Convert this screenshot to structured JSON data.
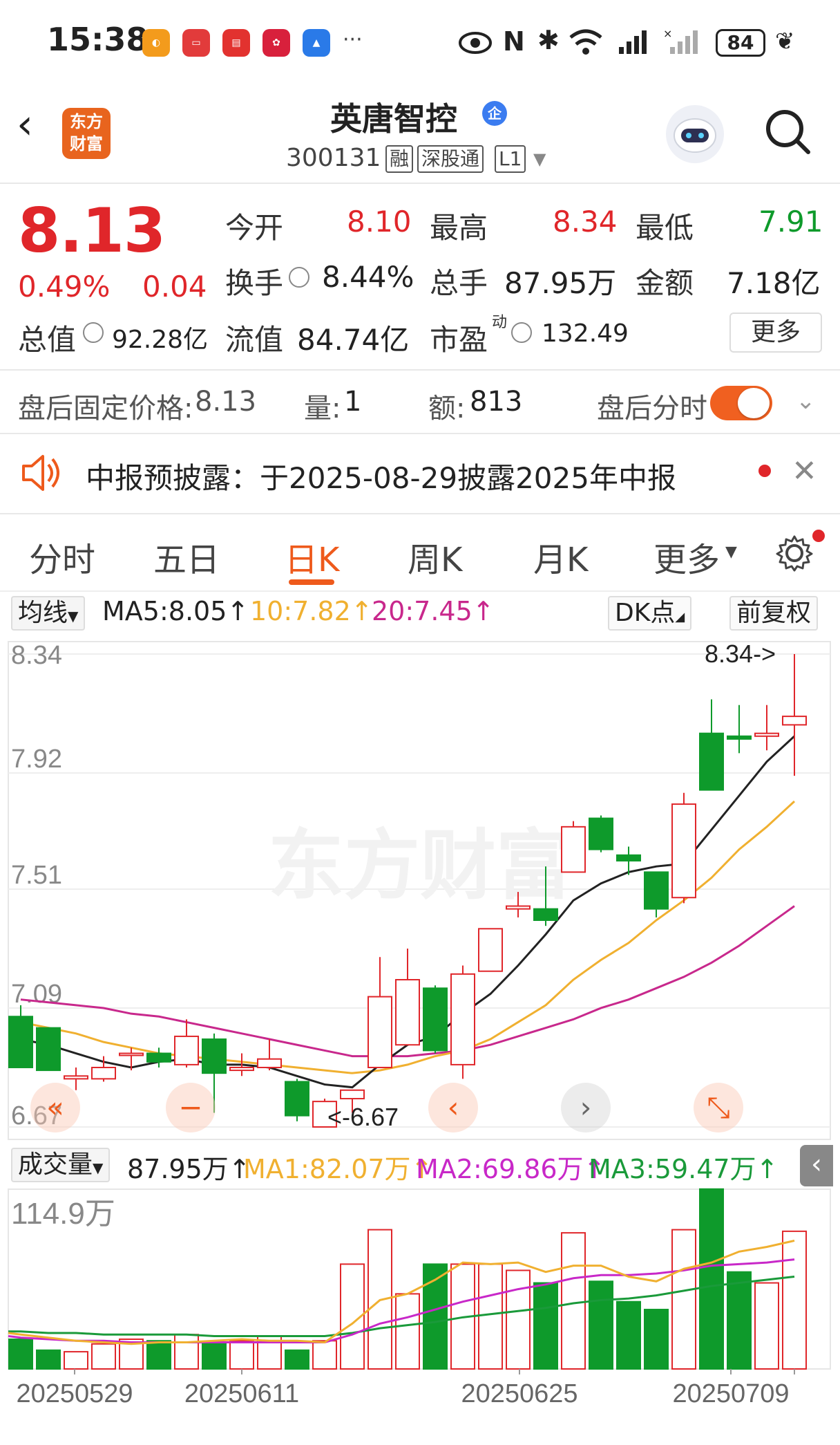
{
  "status_bar": {
    "time": "15:38",
    "battery": "84"
  },
  "header": {
    "logo_text": "东方财富",
    "stock_name": "英唐智控",
    "name_badge": "企",
    "stock_code": "300131",
    "tags": [
      "融",
      "深股通",
      "L1"
    ]
  },
  "quote": {
    "price": "8.13",
    "change_pct": "0.49%",
    "change_abs": "0.04",
    "open_label": "今开",
    "open": "8.10",
    "high_label": "最高",
    "high": "8.34",
    "low_label": "最低",
    "low": "7.91",
    "turnover_label": "换手",
    "turnover": "8.44%",
    "volume_label": "总手",
    "volume": "87.95万",
    "amount_label": "金额",
    "amount": "7.18亿",
    "mktcap_label": "总值",
    "mktcap": "92.28亿",
    "float_label": "流值",
    "float": "84.74亿",
    "pe_label": "市盈",
    "pe_sup": "动",
    "pe": "132.49",
    "more_label": "更多"
  },
  "after_hours": {
    "price_label": "盘后固定价格:",
    "price": "8.13",
    "vol_label": "量:",
    "vol": "1",
    "amount_label": "额:",
    "amount": "813",
    "toggle_label": "盘后分时"
  },
  "announcement": {
    "text": "中报预披露：于2025-08-29披露2025年中报"
  },
  "tabs": [
    {
      "label": "分时"
    },
    {
      "label": "五日"
    },
    {
      "label": "日K"
    },
    {
      "label": "周K"
    },
    {
      "label": "月K"
    },
    {
      "label": "更多"
    }
  ],
  "ma_bar": {
    "selector": "均线",
    "ma5": "MA5:8.05",
    "ma10": "10:7.82",
    "ma20": "20:7.45",
    "dk_label": "DK点",
    "adjust_label": "前复权"
  },
  "colors": {
    "up": "#e0262a",
    "down": "#0e9a2b",
    "ma5": "#222222",
    "ma10": "#f0b030",
    "ma20": "#c8288c",
    "accent": "#ee5a1c"
  },
  "chart_data": [
    {
      "type": "candlestick",
      "y_ticks": [
        "8.34",
        "7.92",
        "7.51",
        "7.09",
        "6.67"
      ],
      "annotations": {
        "high": "8.34->",
        "low": "<-6.67"
      },
      "watermark": "东方财富",
      "candles": [
        {
          "o": 7.06,
          "c": 6.88,
          "h": 7.1,
          "l": 6.88
        },
        {
          "o": 7.02,
          "c": 6.87,
          "h": 7.02,
          "l": 6.87
        },
        {
          "o": 6.84,
          "c": 6.85,
          "h": 6.88,
          "l": 6.8
        },
        {
          "o": 6.84,
          "c": 6.88,
          "h": 6.92,
          "l": 6.83
        },
        {
          "o": 6.93,
          "c": 6.93,
          "h": 6.95,
          "l": 6.87
        },
        {
          "o": 6.93,
          "c": 6.9,
          "h": 6.95,
          "l": 6.88
        },
        {
          "o": 6.89,
          "c": 6.99,
          "h": 7.05,
          "l": 6.88
        },
        {
          "o": 6.98,
          "c": 6.86,
          "h": 7.0,
          "l": 6.72
        },
        {
          "o": 6.87,
          "c": 6.88,
          "h": 6.93,
          "l": 6.85
        },
        {
          "o": 6.88,
          "c": 6.91,
          "h": 6.98,
          "l": 6.87
        },
        {
          "o": 6.83,
          "c": 6.71,
          "h": 6.84,
          "l": 6.69
        },
        {
          "o": 6.67,
          "c": 6.76,
          "h": 6.77,
          "l": 6.67
        },
        {
          "o": 6.77,
          "c": 6.8,
          "h": 6.8,
          "l": 6.72
        },
        {
          "o": 6.88,
          "c": 7.13,
          "h": 7.27,
          "l": 6.88
        },
        {
          "o": 6.96,
          "c": 7.19,
          "h": 7.3,
          "l": 6.96
        },
        {
          "o": 7.16,
          "c": 6.94,
          "h": 7.17,
          "l": 6.93
        },
        {
          "o": 6.89,
          "c": 7.21,
          "h": 7.24,
          "l": 6.84
        },
        {
          "o": 7.22,
          "c": 7.37,
          "h": 7.37,
          "l": 7.22
        },
        {
          "o": 7.44,
          "c": 7.45,
          "h": 7.5,
          "l": 7.41
        },
        {
          "o": 7.44,
          "c": 7.4,
          "h": 7.59,
          "l": 7.38
        },
        {
          "o": 7.57,
          "c": 7.73,
          "h": 7.75,
          "l": 7.57
        },
        {
          "o": 7.76,
          "c": 7.65,
          "h": 7.77,
          "l": 7.64
        },
        {
          "o": 7.63,
          "c": 7.61,
          "h": 7.66,
          "l": 7.56
        },
        {
          "o": 7.57,
          "c": 7.44,
          "h": 7.57,
          "l": 7.41
        },
        {
          "o": 7.48,
          "c": 7.81,
          "h": 7.85,
          "l": 7.46
        },
        {
          "o": 8.06,
          "c": 7.86,
          "h": 8.18,
          "l": 7.86
        },
        {
          "o": 8.05,
          "c": 8.04,
          "h": 8.16,
          "l": 7.99
        },
        {
          "o": 8.05,
          "c": 8.06,
          "h": 8.16,
          "l": 8.0
        },
        {
          "o": 8.09,
          "c": 8.12,
          "h": 8.34,
          "l": 7.91
        }
      ],
      "ma5": [
        6.98,
        6.96,
        6.93,
        6.9,
        6.88,
        6.9,
        6.91,
        6.89,
        6.89,
        6.88,
        6.85,
        6.82,
        6.81,
        6.89,
        6.96,
        6.99,
        7.07,
        7.14,
        7.24,
        7.35,
        7.47,
        7.53,
        7.57,
        7.59,
        7.6,
        7.72,
        7.84,
        7.96,
        8.05
      ],
      "ma10": [
        7.04,
        7.02,
        7.0,
        6.97,
        6.95,
        6.93,
        6.92,
        6.91,
        6.9,
        6.89,
        6.88,
        6.87,
        6.86,
        6.87,
        6.89,
        6.92,
        6.94,
        6.98,
        7.04,
        7.1,
        7.19,
        7.26,
        7.32,
        7.4,
        7.47,
        7.55,
        7.65,
        7.73,
        7.82
      ],
      "ma20": [
        7.12,
        7.11,
        7.1,
        7.09,
        7.07,
        7.06,
        7.04,
        7.02,
        7.0,
        6.98,
        6.96,
        6.94,
        6.92,
        6.92,
        6.92,
        6.93,
        6.94,
        6.96,
        6.99,
        7.02,
        7.05,
        7.09,
        7.12,
        7.16,
        7.2,
        7.25,
        7.31,
        7.38,
        7.45
      ]
    },
    {
      "type": "bar",
      "title": "成交量",
      "current": "87.95万",
      "ma1_label": "MA1:82.07万",
      "ma2_label": "MA2:69.86万",
      "ma3_label": "MA3:59.47万",
      "y_max_label": "114.9万",
      "y_max": 114.9,
      "x_ticks": [
        "20250529",
        "20250611",
        "20250625",
        "20250709"
      ],
      "values": [
        25,
        19,
        12,
        11,
        16,
        19,
        18,
        22,
        16,
        18,
        21,
        12,
        18,
        67,
        89,
        48,
        67,
        67,
        67,
        63,
        55,
        87,
        56,
        43,
        38,
        89,
        115,
        62,
        55,
        88
      ],
      "ma1": [
        23,
        22,
        20,
        18,
        17,
        16,
        17,
        17,
        18,
        19,
        18,
        18,
        17,
        29,
        44,
        48,
        57,
        68,
        67,
        68,
        62,
        66,
        66,
        59,
        56,
        64,
        68,
        75,
        78,
        82
      ],
      "ma2": [
        21,
        20,
        19,
        18,
        18,
        17,
        17,
        17,
        17,
        17,
        17,
        17,
        17,
        22,
        29,
        33,
        38,
        43,
        47,
        51,
        54,
        58,
        60,
        60,
        61,
        63,
        66,
        67,
        68,
        70
      ],
      "ma3": [
        24,
        24,
        23,
        23,
        22,
        22,
        22,
        22,
        21,
        21,
        21,
        21,
        21,
        23,
        26,
        28,
        30,
        33,
        35,
        37,
        39,
        42,
        44,
        45,
        47,
        50,
        53,
        55,
        57,
        59
      ]
    }
  ]
}
